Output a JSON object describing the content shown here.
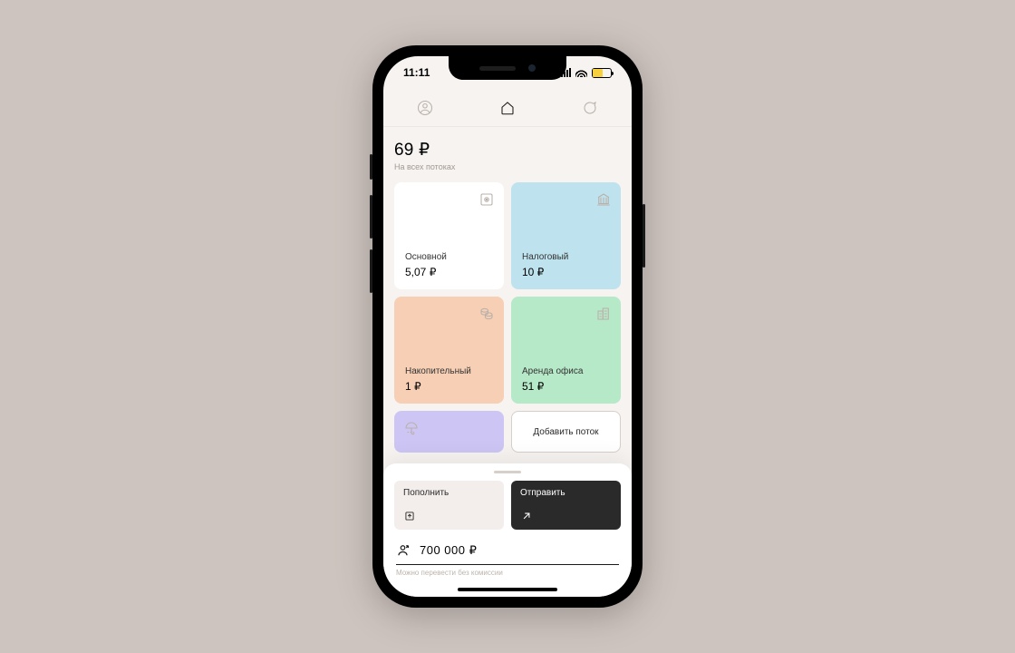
{
  "status": {
    "time": "11:11"
  },
  "balance": {
    "total": "69 ₽",
    "subtitle": "На всех потоках"
  },
  "cards": [
    {
      "name": "Основной",
      "amount": "5,07 ₽",
      "icon": "safe"
    },
    {
      "name": "Налоговый",
      "amount": "10 ₽",
      "icon": "bank"
    },
    {
      "name": "Накопительный",
      "amount": "1 ₽",
      "icon": "coins"
    },
    {
      "name": "Аренда офиса",
      "amount": "51 ₽",
      "icon": "building"
    }
  ],
  "extra_card_icon": "umbrella",
  "add_card_label": "Добавить поток",
  "actions": {
    "deposit": "Пополнить",
    "send": "Отправить"
  },
  "limit": {
    "amount": "700 000 ₽",
    "subtitle": "Можно перевести без комиссии"
  }
}
